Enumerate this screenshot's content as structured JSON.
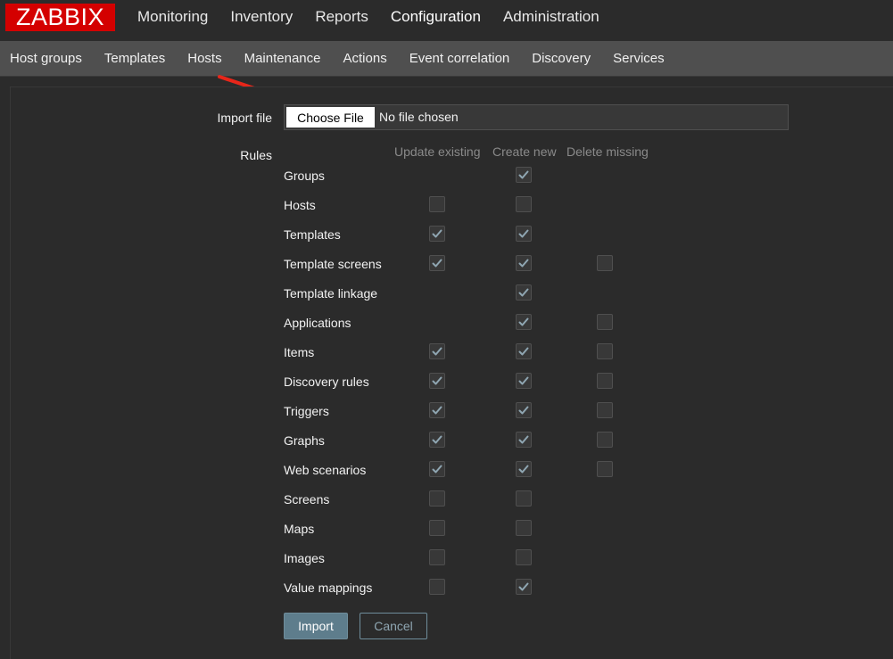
{
  "logo": "ZABBIX",
  "top_nav": [
    "Monitoring",
    "Inventory",
    "Reports",
    "Configuration",
    "Administration"
  ],
  "top_nav_active": "Configuration",
  "sub_nav": [
    "Host groups",
    "Templates",
    "Hosts",
    "Maintenance",
    "Actions",
    "Event correlation",
    "Discovery",
    "Services"
  ],
  "form": {
    "import_file_label": "Import file",
    "choose_file_button": "Choose File",
    "file_status": "No file chosen",
    "rules_label": "Rules",
    "columns": [
      "Update existing",
      "Create new",
      "Delete missing"
    ],
    "rules": [
      {
        "name": "Groups",
        "update": null,
        "create": true,
        "delete": null
      },
      {
        "name": "Hosts",
        "update": false,
        "create": false,
        "delete": null
      },
      {
        "name": "Templates",
        "update": true,
        "create": true,
        "delete": null
      },
      {
        "name": "Template screens",
        "update": true,
        "create": true,
        "delete": false
      },
      {
        "name": "Template linkage",
        "update": null,
        "create": true,
        "delete": null
      },
      {
        "name": "Applications",
        "update": null,
        "create": true,
        "delete": false
      },
      {
        "name": "Items",
        "update": true,
        "create": true,
        "delete": false
      },
      {
        "name": "Discovery rules",
        "update": true,
        "create": true,
        "delete": false
      },
      {
        "name": "Triggers",
        "update": true,
        "create": true,
        "delete": false
      },
      {
        "name": "Graphs",
        "update": true,
        "create": true,
        "delete": false
      },
      {
        "name": "Web scenarios",
        "update": true,
        "create": true,
        "delete": false
      },
      {
        "name": "Screens",
        "update": false,
        "create": false,
        "delete": null
      },
      {
        "name": "Maps",
        "update": false,
        "create": false,
        "delete": null
      },
      {
        "name": "Images",
        "update": false,
        "create": false,
        "delete": null
      },
      {
        "name": "Value mappings",
        "update": false,
        "create": true,
        "delete": null
      }
    ],
    "import_button": "Import",
    "cancel_button": "Cancel"
  },
  "colors": {
    "logo_bg": "#d40000",
    "subnav_bg": "#4f4f4f",
    "page_bg": "#2b2b2b",
    "primary_button": "#5e7d8c",
    "annotation_arrow": "#e8261a"
  }
}
